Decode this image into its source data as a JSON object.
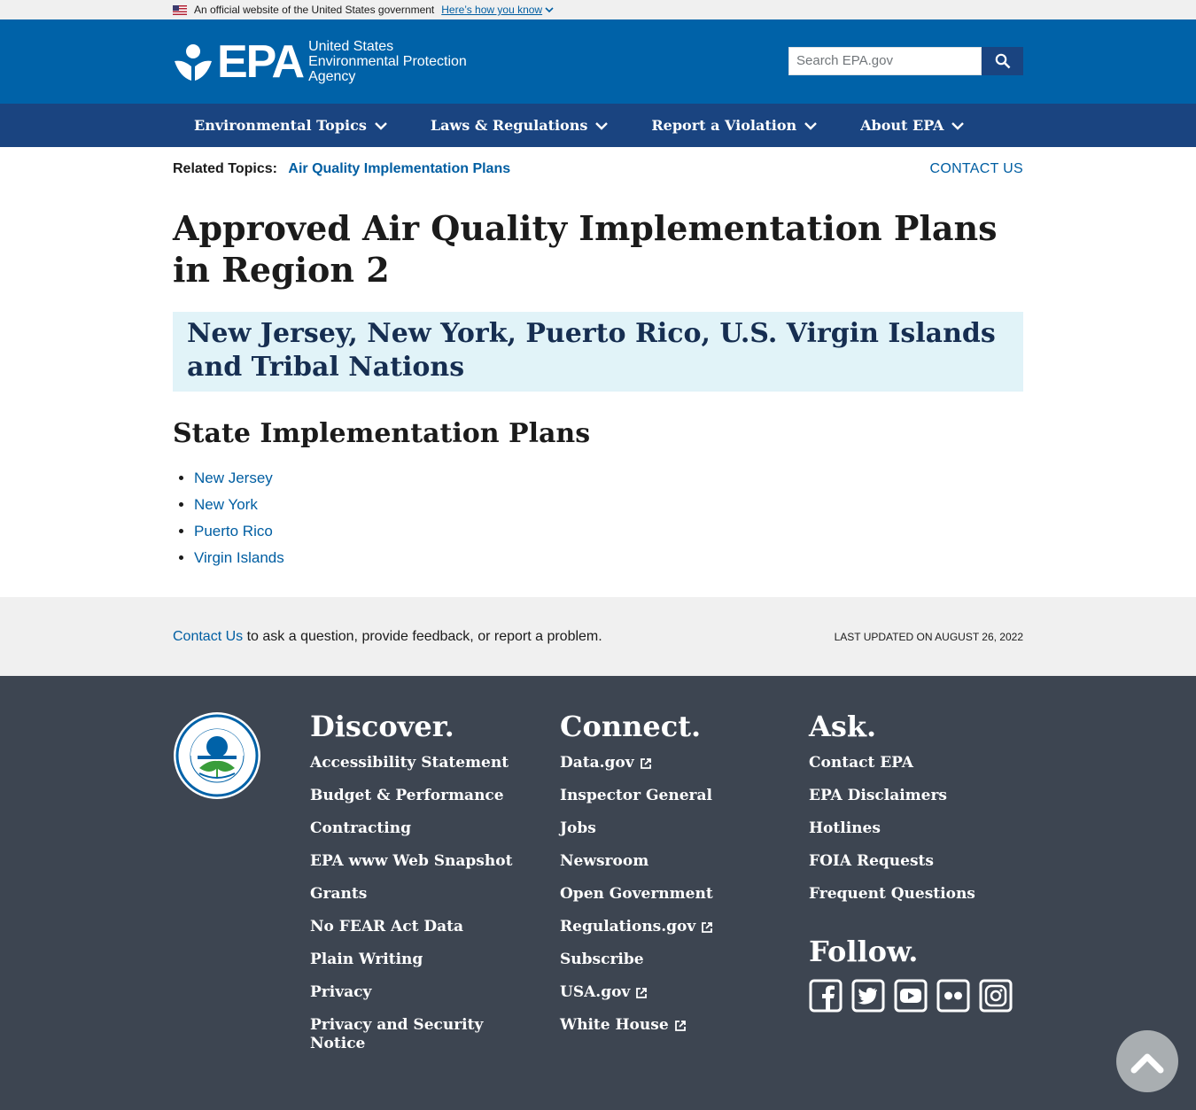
{
  "gov_banner": {
    "text": "An official website of the United States government",
    "link": "Here’s how you know"
  },
  "header": {
    "logo_text": "EPA",
    "logo_sub_1": "United States",
    "logo_sub_2": "Environmental Protection",
    "logo_sub_3": "Agency",
    "search_placeholder": "Search EPA.gov"
  },
  "nav": {
    "items": [
      {
        "label": "Environmental Topics"
      },
      {
        "label": "Laws & Regulations"
      },
      {
        "label": "Report a Violation"
      },
      {
        "label": "About EPA"
      }
    ]
  },
  "related": {
    "label": "Related Topics:",
    "link": "Air Quality Implementation Plans",
    "contact": "CONTACT US"
  },
  "main": {
    "title": "Approved Air Quality Implementation Plans in Region 2",
    "box_heading": "New Jersey, New York, Puerto Rico, U.S. Virgin Islands and Tribal Nations",
    "section_heading": "State Implementation Plans",
    "states": [
      "New Jersey",
      "New York",
      "Puerto Rico",
      "Virgin Islands"
    ]
  },
  "feedback": {
    "link": "Contact Us",
    "text": " to ask a question, provide feedback, or report a problem.",
    "updated": "LAST UPDATED ON AUGUST 26, 2022"
  },
  "footer": {
    "discover": {
      "heading": "Discover.",
      "items": [
        "Accessibility Statement",
        "Budget & Performance",
        "Contracting",
        "EPA www Web Snapshot",
        "Grants",
        "No FEAR Act Data",
        "Plain Writing",
        "Privacy",
        "Privacy and Security Notice"
      ]
    },
    "connect": {
      "heading": "Connect.",
      "items": [
        "Data.gov",
        "Inspector General",
        "Jobs",
        "Newsroom",
        "Open Government",
        "Regulations.gov",
        "Subscribe",
        "USA.gov",
        "White House"
      ]
    },
    "ask": {
      "heading": "Ask.",
      "items": [
        "Contact EPA",
        "EPA Disclaimers",
        "Hotlines",
        "FOIA Requests",
        "Frequent Questions"
      ]
    },
    "follow": {
      "heading": "Follow.",
      "icons": [
        "facebook-icon",
        "twitter-icon",
        "youtube-icon",
        "flickr-icon",
        "instagram-icon"
      ]
    }
  },
  "colors": {
    "header_blue": "#0062a8",
    "nav_blue": "#1a4480",
    "link_blue": "#005ea2",
    "box_bg": "#e1f3f8",
    "footer_bg": "#3d4551"
  }
}
